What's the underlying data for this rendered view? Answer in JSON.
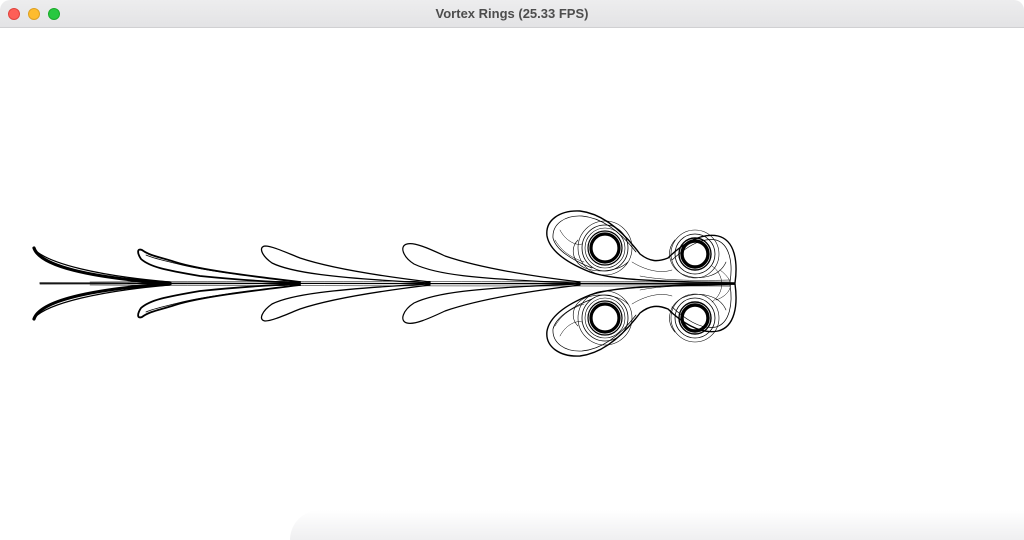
{
  "window": {
    "title": "Vortex Rings (25.33 FPS)"
  },
  "icons": {
    "close": "close-button-icon",
    "minimize": "minimize-button-icon",
    "maximize": "zoom-button-icon"
  },
  "colors": {
    "close": "#fe5f57",
    "minimize": "#febc2e",
    "maximize": "#28c840",
    "ink": "#000000",
    "background": "#ffffff"
  }
}
